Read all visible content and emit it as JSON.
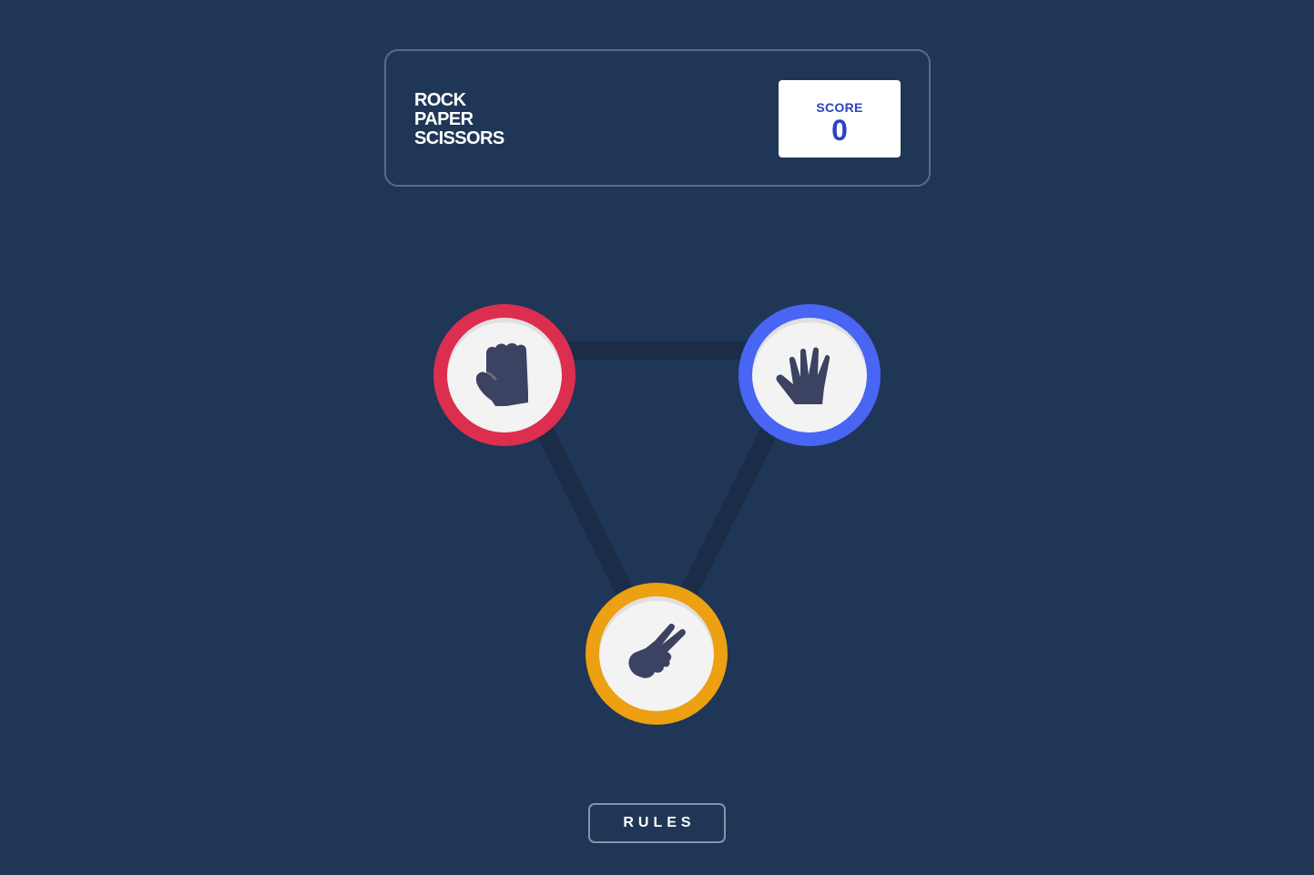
{
  "app": {
    "title_lines": [
      "ROCK",
      "PAPER",
      "SCISSORS"
    ]
  },
  "score": {
    "label": "SCORE",
    "value": "0"
  },
  "choices": [
    {
      "id": "rock",
      "icon": "rock-hand-icon",
      "color": "#dc2e4e"
    },
    {
      "id": "paper",
      "icon": "paper-hand-icon",
      "color": "#4865f4"
    },
    {
      "id": "scissors",
      "icon": "scissors-hand-icon",
      "color": "#eca012"
    }
  ],
  "rules_button": {
    "label": "RULES"
  },
  "colors": {
    "background": "#1f3656",
    "triangle": "#1a2c48",
    "icon_fill": "#3b4262",
    "score_value": "#2a45c2"
  }
}
